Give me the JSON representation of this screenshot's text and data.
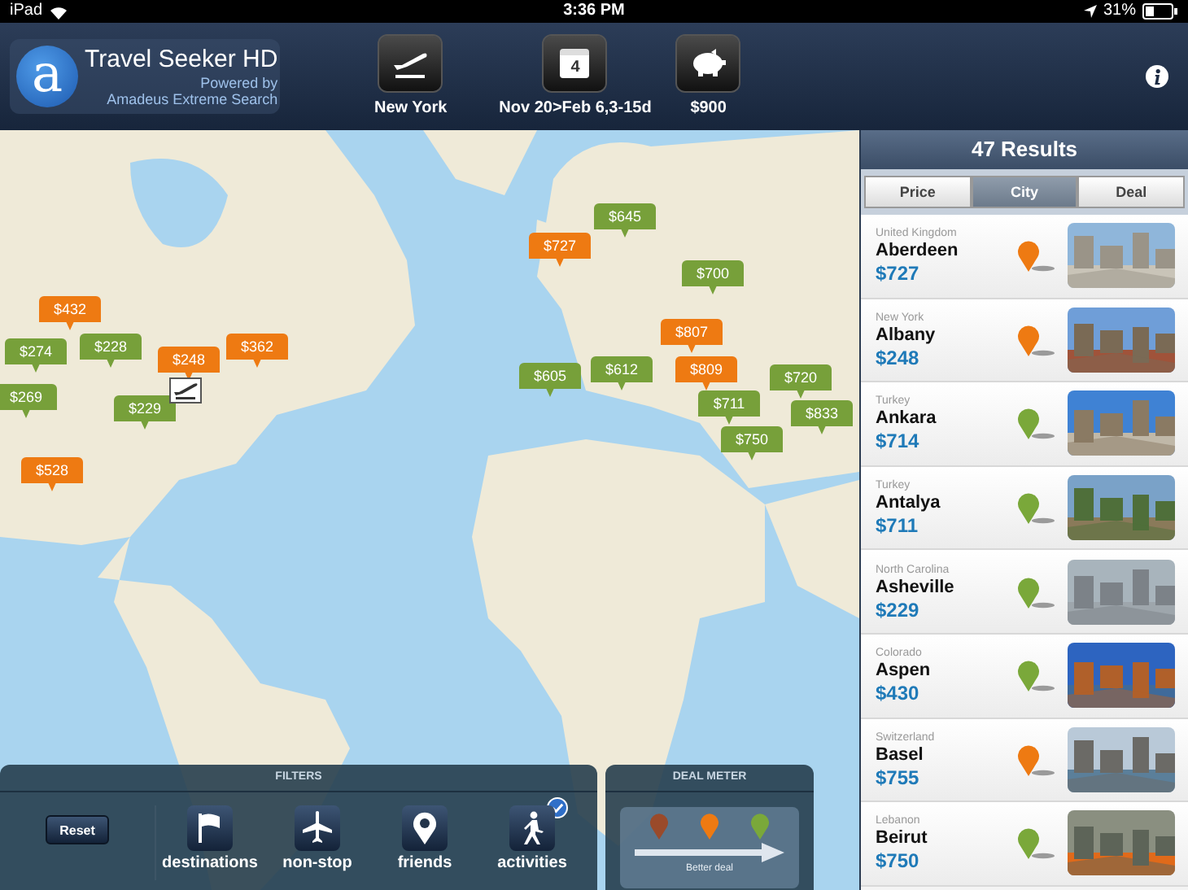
{
  "status_bar": {
    "device": "iPad",
    "time": "3:36 PM",
    "battery": "31%"
  },
  "header": {
    "logo_letter": "a",
    "title": "Travel Seeker HD",
    "subtitle_1": "Powered by",
    "subtitle_2": "Amadeus Extreme Search",
    "search_buttons": [
      {
        "kind": "origin",
        "label": "New York"
      },
      {
        "kind": "dates",
        "label": "Nov 20>Feb 6,3-15d",
        "icon_text": "4"
      },
      {
        "kind": "budget",
        "label": "$900"
      }
    ]
  },
  "map": {
    "pins": [
      {
        "price": "$432",
        "color": "#ee7a12"
      },
      {
        "price": "$274",
        "color": "#77a03a"
      },
      {
        "price": "$228",
        "color": "#77a03a"
      },
      {
        "price": "$269",
        "color": "#77a03a"
      },
      {
        "price": "$248",
        "color": "#ee7a12"
      },
      {
        "price": "$362",
        "color": "#ee7a12"
      },
      {
        "price": "$229",
        "color": "#77a03a"
      },
      {
        "price": "$528",
        "color": "#ee7a12"
      },
      {
        "price": "$727",
        "color": "#ee7a12"
      },
      {
        "price": "$645",
        "color": "#77a03a"
      },
      {
        "price": "$700",
        "color": "#77a03a"
      },
      {
        "price": "$807",
        "color": "#ee7a12"
      },
      {
        "price": "$605",
        "color": "#77a03a"
      },
      {
        "price": "$612",
        "color": "#77a03a"
      },
      {
        "price": "$809",
        "color": "#ee7a12"
      },
      {
        "price": "$711",
        "color": "#77a03a"
      },
      {
        "price": "$750",
        "color": "#77a03a"
      },
      {
        "price": "$720",
        "color": "#77a03a"
      },
      {
        "price": "$833",
        "color": "#77a03a"
      }
    ]
  },
  "filters": {
    "title": "FILTERS",
    "reset": "Reset",
    "items": [
      {
        "kind": "destinations",
        "label": "destinations",
        "checked": false
      },
      {
        "kind": "non-stop",
        "label": "non-stop",
        "checked": false
      },
      {
        "kind": "friends",
        "label": "friends",
        "checked": false
      },
      {
        "kind": "activities",
        "label": "activities",
        "checked": true
      }
    ]
  },
  "deal_meter": {
    "title": "DEAL METER",
    "levels": [
      {
        "color": "#9a4a2a"
      },
      {
        "color": "#ee7a12"
      },
      {
        "color": "#7aa83a"
      }
    ],
    "caption": "Better deal"
  },
  "results": {
    "title": "47 Results",
    "sort_tabs": [
      {
        "label": "Price",
        "selected": false
      },
      {
        "label": "City",
        "selected": true
      },
      {
        "label": "Deal",
        "selected": false
      }
    ],
    "items": [
      {
        "region": "United Kingdom",
        "city": "Aberdeen",
        "price": "$727",
        "color": "#ee7a12"
      },
      {
        "region": "New York",
        "city": "Albany",
        "price": "$248",
        "color": "#ee7a12"
      },
      {
        "region": "Turkey",
        "city": "Ankara",
        "price": "$714",
        "color": "#7aa83a"
      },
      {
        "region": "Turkey",
        "city": "Antalya",
        "price": "$711",
        "color": "#7aa83a"
      },
      {
        "region": "North Carolina",
        "city": "Asheville",
        "price": "$229",
        "color": "#7aa83a"
      },
      {
        "region": "Colorado",
        "city": "Aspen",
        "price": "$430",
        "color": "#7aa83a"
      },
      {
        "region": "Switzerland",
        "city": "Basel",
        "price": "$755",
        "color": "#ee7a12"
      },
      {
        "region": "Lebanon",
        "city": "Beirut",
        "price": "$750",
        "color": "#7aa83a"
      }
    ]
  }
}
